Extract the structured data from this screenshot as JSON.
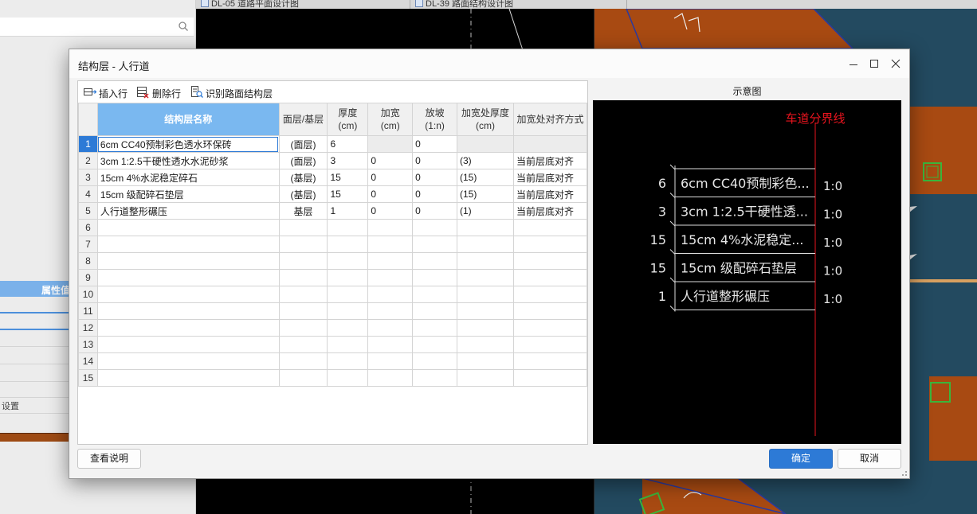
{
  "background": {
    "tabs": [
      "DL-05 道路平面设计图",
      "DL-39 路面结构设计图"
    ],
    "property_header": "属性值",
    "setting_text": "设置"
  },
  "dialog": {
    "title": "结构层 - 人行道",
    "toolbar": {
      "insert_row": "插入行",
      "delete_row": "删除行",
      "identify": "识别路面结构层"
    },
    "columns": [
      "结构层名称",
      "面层/基层",
      "厚度\n(cm)",
      "加宽\n(cm)",
      "放坡\n(1:n)",
      "加宽处厚度\n(cm)",
      "加宽处对齐方式"
    ],
    "rows": [
      {
        "num": "1",
        "name": "6cm CC40预制彩色透水环保砖",
        "type": "(面层)",
        "thickness": "6",
        "widen": "",
        "slope": "0",
        "widen_thickness": "",
        "align": ""
      },
      {
        "num": "2",
        "name": "3cm 1:2.5干硬性透水水泥砂浆",
        "type": "(面层)",
        "thickness": "3",
        "widen": "0",
        "slope": "0",
        "widen_thickness": "(3)",
        "align": "当前层底对齐"
      },
      {
        "num": "3",
        "name": "15cm 4%水泥稳定碎石",
        "type": "(基层)",
        "thickness": "15",
        "widen": "0",
        "slope": "0",
        "widen_thickness": "(15)",
        "align": "当前层底对齐"
      },
      {
        "num": "4",
        "name": "15cm 级配碎石垫层",
        "type": "(基层)",
        "thickness": "15",
        "widen": "0",
        "slope": "0",
        "widen_thickness": "(15)",
        "align": "当前层底对齐"
      },
      {
        "num": "5",
        "name": "人行道整形碾压",
        "type": "基层",
        "thickness": "1",
        "widen": "0",
        "slope": "0",
        "widen_thickness": "(1)",
        "align": "当前层底对齐"
      },
      {
        "num": "6"
      },
      {
        "num": "7"
      },
      {
        "num": "8"
      },
      {
        "num": "9"
      },
      {
        "num": "10"
      },
      {
        "num": "11"
      },
      {
        "num": "12"
      },
      {
        "num": "13"
      },
      {
        "num": "14"
      },
      {
        "num": "15"
      }
    ],
    "preview": {
      "label": "示意图",
      "boundary_label": "车道分界线",
      "layers": [
        {
          "thickness": "6",
          "name": "6cm CC40预制彩色...",
          "slope": "1:0"
        },
        {
          "thickness": "3",
          "name": "3cm 1:2.5干硬性透...",
          "slope": "1:0"
        },
        {
          "thickness": "15",
          "name": "15cm 4%水泥稳定...",
          "slope": "1:0"
        },
        {
          "thickness": "15",
          "name": "15cm 级配碎石垫层",
          "slope": "1:0"
        },
        {
          "thickness": "1",
          "name": "人行道整形碾压",
          "slope": "1:0"
        }
      ]
    },
    "buttons": {
      "help": "查看说明",
      "ok": "确定",
      "cancel": "取消"
    }
  },
  "colors": {
    "accent": "#2d7ad6",
    "header_highlight": "#7ab8f0",
    "preview_red": "#e8141e",
    "road_orange": "#a84a12",
    "road_blue": "#234a60"
  }
}
